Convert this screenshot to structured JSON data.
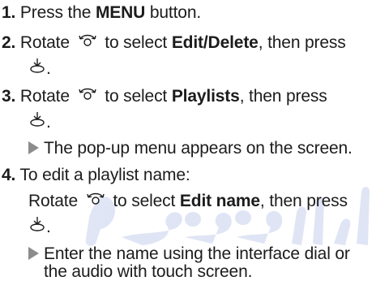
{
  "steps": [
    {
      "num": "1.",
      "parts": [
        "Press the ",
        "MENU",
        " button."
      ]
    },
    {
      "num": "2.",
      "parts": [
        "Rotate ",
        " to select ",
        "Edit/Delete",
        ", then press"
      ],
      "cont": "."
    },
    {
      "num": "3.",
      "parts": [
        "Rotate ",
        " to select ",
        "Playlists",
        ", then press"
      ],
      "cont": ".",
      "note": "The pop-up menu appears on the screen."
    },
    {
      "num": "4.",
      "intro": "To edit a playlist name:",
      "parts": [
        "Rotate ",
        " to select ",
        "Edit name",
        ", then press"
      ],
      "cont": ".",
      "note_line1": "Enter the name using the interface dial or",
      "note_line2": "the audio with touch screen."
    }
  ],
  "icons": {
    "rotate": "rotate-dial-icon",
    "enter": "enter-press-icon",
    "arrow": "note-arrow-icon"
  },
  "colors": {
    "text": "#1c1c1c",
    "arrow": "#8c8c8c",
    "watermark": "#1a3fb8"
  }
}
